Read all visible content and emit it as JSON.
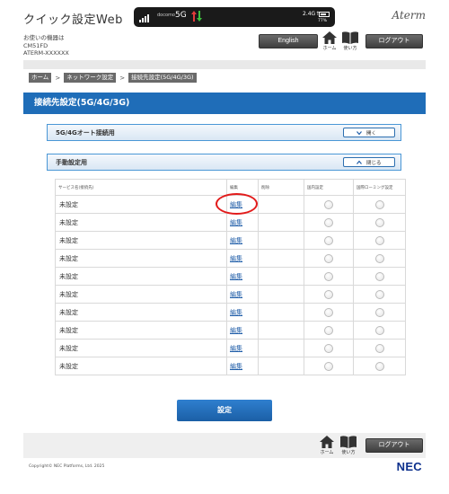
{
  "header": {
    "app_title": "クイック設定Web",
    "device_label": "お使いの機器は",
    "device_model": "CM51FD",
    "device_id": "ATERM-XXXXXX",
    "brand": "Aterm",
    "english_label": "English",
    "home_label": "ホーム",
    "manual_label": "使い方",
    "logout_label": "ログアウト"
  },
  "status_bar": {
    "carrier": "docomo",
    "network": "5G",
    "speed": "2.4G↑",
    "battery_pct": "77%",
    "battery_level": 0.77,
    "arrow_up_color": "#e23b3b",
    "arrow_down_color": "#3cc13c"
  },
  "breadcrumb": [
    "ホーム",
    "ネットワーク設定",
    "接続先設定(5G/4G/3G)"
  ],
  "page_title": "接続先設定(5G/4G/3G)",
  "sections": {
    "auto": {
      "title": "5G/4Gオート接続用",
      "toggle_label": "開く",
      "icon": "chevron-down-icon"
    },
    "manual": {
      "title": "手動設定用",
      "toggle_label": "閉じる",
      "icon": "chevron-up-icon"
    }
  },
  "table": {
    "headers": [
      "サービス名(接続先)",
      "編集",
      "削除",
      "国内設定",
      "国際ローミング設定"
    ],
    "edit_label": "編集",
    "rows": [
      "未設定",
      "未設定",
      "未設定",
      "未設定",
      "未設定",
      "未設定",
      "未設定",
      "未設定",
      "未設定",
      "未設定"
    ]
  },
  "submit_label": "設定",
  "footer": {
    "home_label": "ホーム",
    "manual_label": "使い方",
    "logout_label": "ログアウト",
    "copyright": "Copyright© NEC Platforms, Ltd. 2025",
    "logo": "NEC"
  },
  "colors": {
    "primary_blue": "#1f6db8",
    "highlight_red": "#e21b1b",
    "link_blue": "#1f5da8"
  }
}
